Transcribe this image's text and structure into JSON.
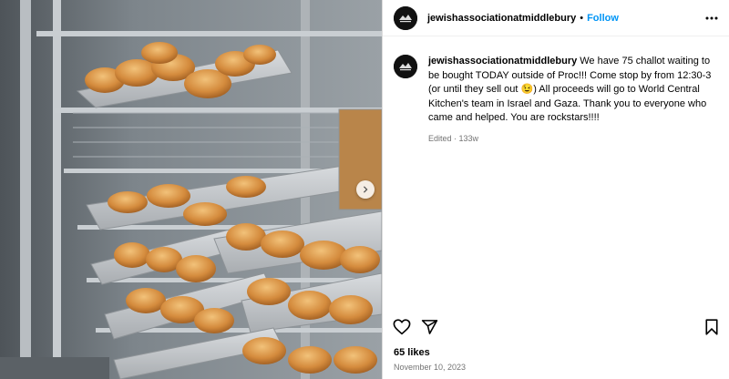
{
  "post": {
    "username": "jewishassociationatmiddlebury",
    "separator": "•",
    "follow_label": "Follow",
    "caption_text": "We have 75 challot waiting to be bought TODAY outside of Proc!!! Come stop by from 12:30-3 (or until they sell out 😉) All proceeds will go to World Central Kitchen's team in Israel and Gaza. Thank you to everyone who came and helped. You are rockstars!!!!",
    "caption_meta": "Edited · 133w",
    "likes": "65 likes",
    "date": "November 10, 2023"
  },
  "icons": {
    "more": "more-horizontal-icon",
    "like": "heart-icon",
    "share": "send-icon",
    "save": "bookmark-icon",
    "carousel_next": "chevron-right-icon"
  },
  "colors": {
    "accent": "#0095f6",
    "muted": "#737373",
    "border": "#dbdbdb"
  }
}
